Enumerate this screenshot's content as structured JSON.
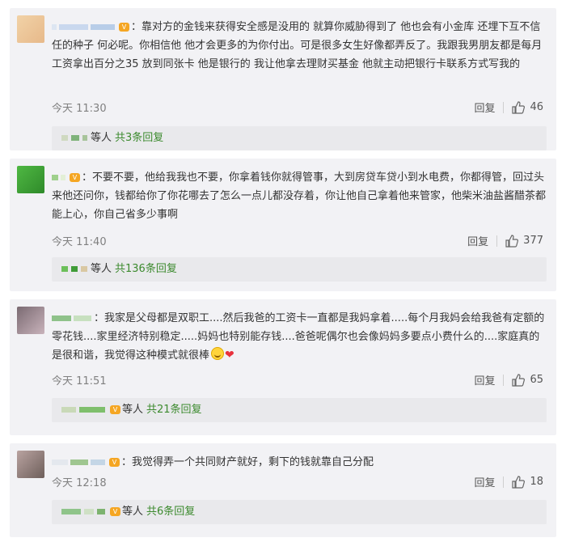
{
  "comments": [
    {
      "text": "靠对方的金钱来获得安全感是没用的 就算你威胁得到了 他也会有小金库 还埋下互不信任的种子 何必呢。你相信他 他才会更多的为你付出。可是很多女生好像都弄反了。我跟我男朋友都是每月工资拿出百分之35 放到同张卡 他是银行的 我让他拿去理财买基金 他就主动把银行卡联系方式写我的",
      "time": "今天 11:30",
      "reply_label": "回复",
      "likes": "46",
      "sub_who": "等人",
      "sub_count": "共3条回复"
    },
    {
      "text": "不要不要，他给我我也不要，你拿着钱你就得管事，大到房贷车贷小到水电费，你都得管，回过头来他还问你，钱都给你了你花哪去了怎么一点儿都没存着，你让他自己拿着他来管家，他柴米油盐酱醋茶都能上心，你自己省多少事啊",
      "time": "今天 11:40",
      "reply_label": "回复",
      "likes": "377",
      "sub_who": "等人",
      "sub_count": "共136条回复"
    },
    {
      "text": "我家是父母都是双职工....然后我爸的工资卡一直都是我妈拿着.....每个月我妈会给我爸有定额的零花钱....家里经济特别稳定.....妈妈也特别能存钱....爸爸呢偶尔也会像妈妈多要点小费什么的....家庭真的是很和谐，我觉得这种模式就很棒",
      "time": "今天 11:51",
      "reply_label": "回复",
      "likes": "65",
      "sub_who": "等人",
      "sub_count": "共21条回复"
    },
    {
      "text": "我觉得弄一个共同财产就好，剩下的钱就靠自己分配",
      "time": "今天 12:18",
      "reply_label": "回复",
      "likes": "18",
      "sub_who": "等人",
      "sub_count": "共6条回复"
    }
  ],
  "colors": {
    "card_bg": "#f2f2f5",
    "sub_bg": "#e9e9ec",
    "link_green": "#3c8a2e",
    "vip_orange": "#f5a623",
    "heart_red": "#e8313c"
  }
}
